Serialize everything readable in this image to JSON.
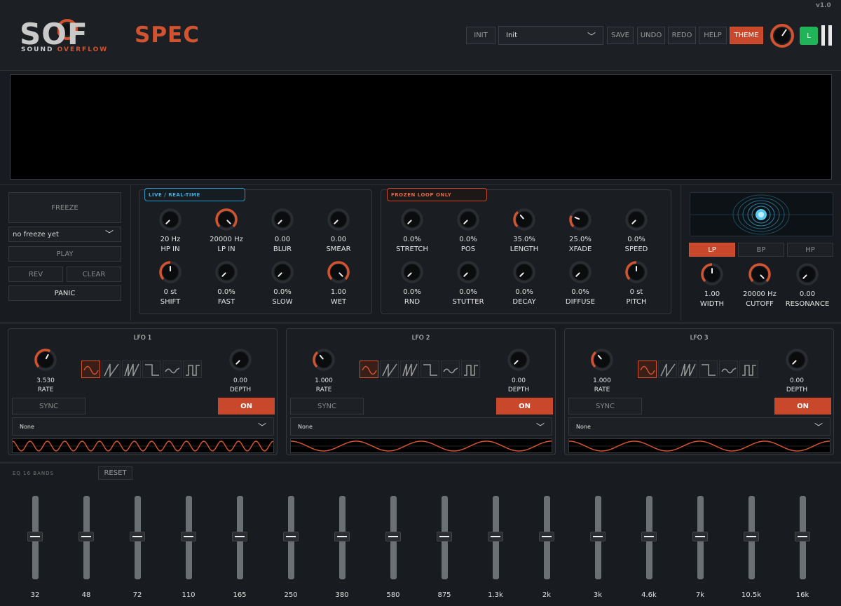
{
  "header": {
    "logo_text": "SOF",
    "logo_sub1": "SOUND",
    "logo_sub2": "OVERFLOW",
    "plugin_name": "SPEC",
    "version": "v1.0",
    "init_label": "INIT",
    "preset": "Init",
    "save_label": "SAVE",
    "undo_label": "UNDO",
    "redo_label": "REDO",
    "help_label": "HELP",
    "theme_label": "THEME",
    "led_label": "L"
  },
  "freeze": {
    "freeze_label": "FREEZE",
    "slot_status": "no freeze yet",
    "play_label": "PLAY",
    "rev_label": "REV",
    "clear_label": "CLEAR",
    "panic_label": "PANIC"
  },
  "live": {
    "tag": "LIVE / REAL-TIME",
    "knobs": [
      {
        "value": "20 Hz",
        "label": "HP IN",
        "amount": 0.0
      },
      {
        "value": "20000 Hz",
        "label": "LP IN",
        "amount": 1.0
      },
      {
        "value": "0.00",
        "label": "BLUR",
        "amount": 0.0
      },
      {
        "value": "0.00",
        "label": "SMEAR",
        "amount": 0.0
      },
      {
        "value": "0 st",
        "label": "SHIFT",
        "amount": 0.5
      },
      {
        "value": "0.0%",
        "label": "FAST",
        "amount": 0.0
      },
      {
        "value": "0.0%",
        "label": "SLOW",
        "amount": 0.0
      },
      {
        "value": "1.00",
        "label": "WET",
        "amount": 1.0
      }
    ]
  },
  "frozen": {
    "tag": "FROZEN LOOP ONLY",
    "knobs": [
      {
        "value": "0.0%",
        "label": "STRETCH",
        "amount": 0.0
      },
      {
        "value": "0.0%",
        "label": "POS",
        "amount": 0.0
      },
      {
        "value": "35.0%",
        "label": "LENGTH",
        "amount": 0.35
      },
      {
        "value": "25.0%",
        "label": "XFADE",
        "amount": 0.25
      },
      {
        "value": "0.0%",
        "label": "SPEED",
        "amount": 0.0
      },
      {
        "value": "0.0%",
        "label": "RND",
        "amount": 0.0
      },
      {
        "value": "0.0%",
        "label": "STUTTER",
        "amount": 0.0
      },
      {
        "value": "0.0%",
        "label": "DECAY",
        "amount": 0.0
      },
      {
        "value": "0.0%",
        "label": "DIFFUSE",
        "amount": 0.0
      },
      {
        "value": "0 st",
        "label": "PITCH",
        "amount": 0.5
      }
    ]
  },
  "filter": {
    "modes": [
      "LP",
      "BP",
      "HP"
    ],
    "active_mode": "LP",
    "knobs": [
      {
        "value": "1.00",
        "label": "WIDTH",
        "amount": 0.5
      },
      {
        "value": "20000 Hz",
        "label": "CUTOFF",
        "amount": 1.0
      },
      {
        "value": "0.00",
        "label": "RESONANCE",
        "amount": 0.0
      }
    ]
  },
  "lfos": [
    {
      "title": "LFO 1",
      "rate_value": "3.530",
      "rate_label": "RATE",
      "rate_amount": 0.6,
      "depth_value": "0.00",
      "depth_label": "DEPTH",
      "depth_amount": 0.0,
      "sync_label": "SYNC",
      "on_label": "ON",
      "target": "None",
      "cycles": 15
    },
    {
      "title": "LFO 2",
      "rate_value": "1.000",
      "rate_label": "RATE",
      "rate_amount": 0.35,
      "depth_value": "0.00",
      "depth_label": "DEPTH",
      "depth_amount": 0.0,
      "sync_label": "SYNC",
      "on_label": "ON",
      "target": "None",
      "cycles": 4
    },
    {
      "title": "LFO 3",
      "rate_value": "1.000",
      "rate_label": "RATE",
      "rate_amount": 0.35,
      "depth_value": "0.00",
      "depth_label": "DEPTH",
      "depth_amount": 0.0,
      "sync_label": "SYNC",
      "on_label": "ON",
      "target": "None",
      "cycles": 4
    }
  ],
  "eq": {
    "label": "EQ 16 BANDS",
    "reset_label": "RESET",
    "bands": [
      "32",
      "48",
      "72",
      "110",
      "165",
      "250",
      "380",
      "580",
      "875",
      "1.3k",
      "2k",
      "3k",
      "4.6k",
      "7k",
      "10.5k",
      "16k"
    ],
    "gains": [
      0,
      0,
      0,
      0,
      0,
      0,
      0,
      0,
      0,
      0,
      0,
      0,
      0,
      0,
      0,
      0
    ]
  },
  "colors": {
    "accent": "#d2532f",
    "live_accent": "#3fb0e0",
    "led_green": "#21b357"
  }
}
